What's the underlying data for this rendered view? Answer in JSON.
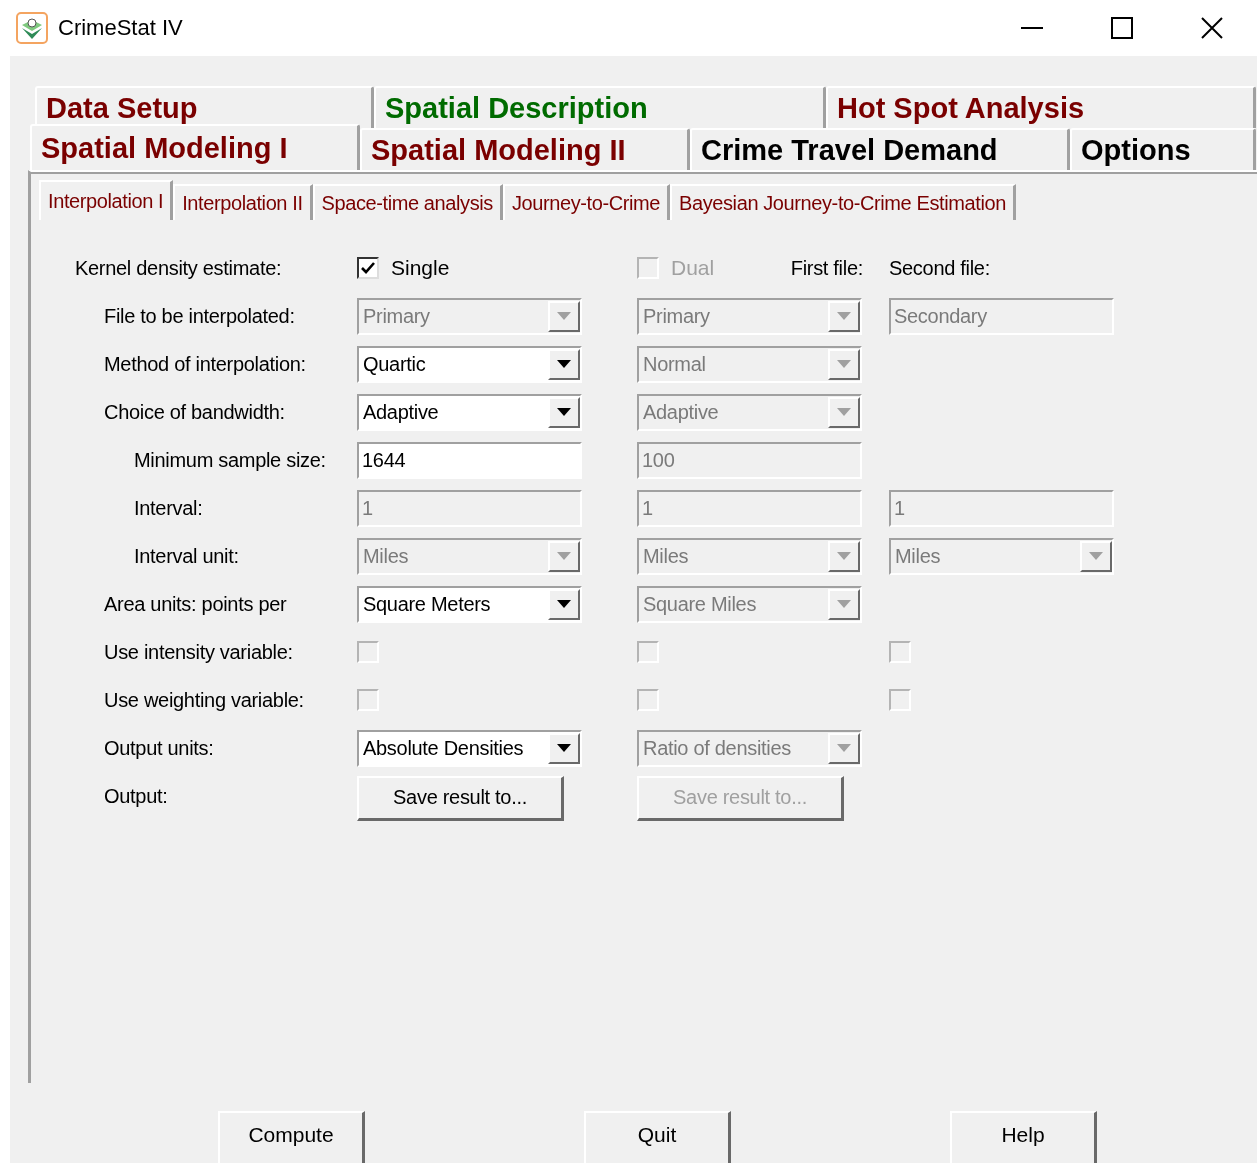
{
  "window": {
    "title": "CrimeStat IV"
  },
  "main_tabs": [
    [
      {
        "label": "Data Setup",
        "color": "#7a0000",
        "selected": false
      },
      {
        "label": "Spatial Description",
        "color": "#006b00",
        "selected": false
      },
      {
        "label": "Hot Spot Analysis",
        "color": "#7a0000",
        "selected": false
      }
    ],
    [
      {
        "label": "Spatial Modeling I",
        "color": "#7a0000",
        "selected": true
      },
      {
        "label": "Spatial Modeling II",
        "color": "#7a0000",
        "selected": false
      },
      {
        "label": "Crime Travel Demand",
        "color": "#000000",
        "selected": false
      },
      {
        "label": "Options",
        "color": "#000000",
        "selected": false
      }
    ]
  ],
  "sub_tabs": [
    {
      "label": "Interpolation I",
      "selected": true
    },
    {
      "label": "Interpolation II",
      "selected": false
    },
    {
      "label": "Space-time analysis",
      "selected": false
    },
    {
      "label": "Journey-to-Crime",
      "selected": false
    },
    {
      "label": "Bayesian Journey-to-Crime Estimation",
      "selected": false
    }
  ],
  "form_rows": [
    {
      "label": "Kernel density estimate:",
      "kind": "top",
      "cells": [
        {
          "kind": "checkbox",
          "label": "Single",
          "checked": true,
          "disabled": false
        },
        {
          "kind": "checkbox",
          "label": "Dual",
          "checked": false,
          "disabled": true,
          "note": "First file:"
        },
        {
          "kind": "text",
          "label": "Second file:"
        }
      ]
    },
    {
      "label": "File to be interpolated:",
      "kind": "main",
      "cells": [
        {
          "kind": "select",
          "value": "Primary",
          "disabled": true
        },
        {
          "kind": "select",
          "value": "Primary",
          "disabled": true
        },
        {
          "kind": "input",
          "value": "Secondary",
          "disabled": true
        }
      ]
    },
    {
      "label": "Method of interpolation:",
      "kind": "main",
      "cells": [
        {
          "kind": "select",
          "value": "Quartic",
          "disabled": false
        },
        {
          "kind": "select",
          "value": "Normal",
          "disabled": true
        },
        {
          "kind": "blank"
        }
      ]
    },
    {
      "label": "Choice of bandwidth:",
      "kind": "main",
      "cells": [
        {
          "kind": "select",
          "value": "Adaptive",
          "disabled": false
        },
        {
          "kind": "select",
          "value": "Adaptive",
          "disabled": true
        },
        {
          "kind": "blank"
        }
      ]
    },
    {
      "label": "Minimum sample size:",
      "kind": "sub",
      "cells": [
        {
          "kind": "input",
          "value": "1644",
          "disabled": false
        },
        {
          "kind": "input",
          "value": "100",
          "disabled": true
        },
        {
          "kind": "blank"
        }
      ]
    },
    {
      "label": "Interval:",
      "kind": "sub",
      "cells": [
        {
          "kind": "input",
          "value": "1",
          "disabled": true
        },
        {
          "kind": "input",
          "value": "1",
          "disabled": true
        },
        {
          "kind": "input",
          "value": "1",
          "disabled": true
        }
      ]
    },
    {
      "label": "Interval unit:",
      "kind": "sub",
      "cells": [
        {
          "kind": "select",
          "value": "Miles",
          "disabled": true
        },
        {
          "kind": "select",
          "value": "Miles",
          "disabled": true
        },
        {
          "kind": "select",
          "value": "Miles",
          "disabled": true
        }
      ]
    },
    {
      "label": "Area units: points per",
      "kind": "main",
      "cells": [
        {
          "kind": "select",
          "value": "Square Meters",
          "disabled": false
        },
        {
          "kind": "select",
          "value": "Square Miles",
          "disabled": true
        },
        {
          "kind": "blank"
        }
      ]
    },
    {
      "label": "Use intensity variable:",
      "kind": "main",
      "cells": [
        {
          "kind": "checkbox",
          "checked": false,
          "disabled": true
        },
        {
          "kind": "checkbox",
          "checked": false,
          "disabled": true
        },
        {
          "kind": "checkbox",
          "checked": false,
          "disabled": true
        }
      ]
    },
    {
      "label": "Use weighting variable:",
      "kind": "main",
      "cells": [
        {
          "kind": "checkbox",
          "checked": false,
          "disabled": true
        },
        {
          "kind": "checkbox",
          "checked": false,
          "disabled": true
        },
        {
          "kind": "checkbox",
          "checked": false,
          "disabled": true
        }
      ]
    },
    {
      "label": "Output units:",
      "kind": "main",
      "cells": [
        {
          "kind": "select",
          "value": "Absolute Densities",
          "disabled": false
        },
        {
          "kind": "select",
          "value": "Ratio of densities",
          "disabled": true
        },
        {
          "kind": "blank"
        }
      ]
    },
    {
      "label": "Output:",
      "kind": "main",
      "cells": [
        {
          "kind": "button",
          "label": "Save result to...",
          "disabled": false
        },
        {
          "kind": "button",
          "label": "Save result to...",
          "disabled": true
        },
        {
          "kind": "blank"
        }
      ]
    }
  ],
  "bottom_buttons": [
    "Compute",
    "Quit",
    "Help"
  ]
}
